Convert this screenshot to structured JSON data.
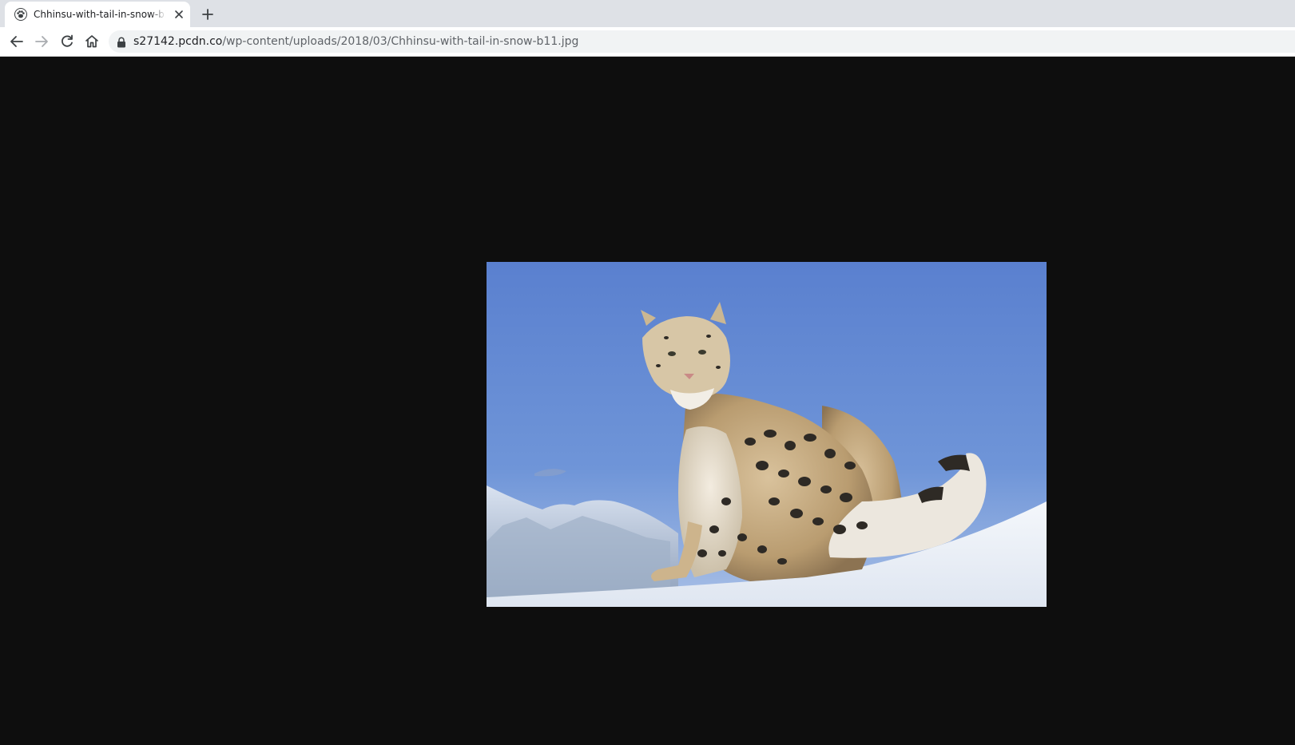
{
  "tab": {
    "title": "Chhinsu-with-tail-in-snow-b11.jpg",
    "favicon": "paw-favicon-icon"
  },
  "toolbar": {
    "back_icon": "back-arrow-icon",
    "forward_icon": "forward-arrow-icon",
    "reload_icon": "reload-icon",
    "home_icon": "home-icon"
  },
  "address_bar": {
    "host": "s27142.pcdn.co",
    "path": "/wp-content/uploads/2018/03/Chhinsu-with-tail-in-snow-b11.jpg",
    "secure_icon": "lock-icon"
  },
  "colors": {
    "tabstrip": "#dee1e6",
    "page_background": "#0e0e0e",
    "sky": "#5f86cf",
    "snow": "#eef2f8"
  }
}
